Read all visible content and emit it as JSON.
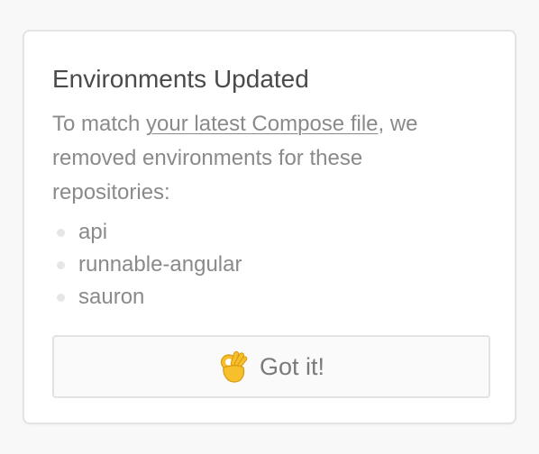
{
  "dialog": {
    "title": "Environments Updated",
    "message_prefix": "To match ",
    "message_link": "your latest Compose file",
    "message_suffix": ", we removed environments for these repositories:",
    "repositories": [
      "api",
      "runnable-angular",
      "sauron"
    ],
    "button": {
      "icon": "ok-hand-icon",
      "label": "Got it!"
    }
  },
  "colors": {
    "background": "#f8f8f8",
    "card": "#ffffff",
    "title": "#4a4a4a",
    "text": "#8a8a8a",
    "border": "#e4e4e4"
  }
}
